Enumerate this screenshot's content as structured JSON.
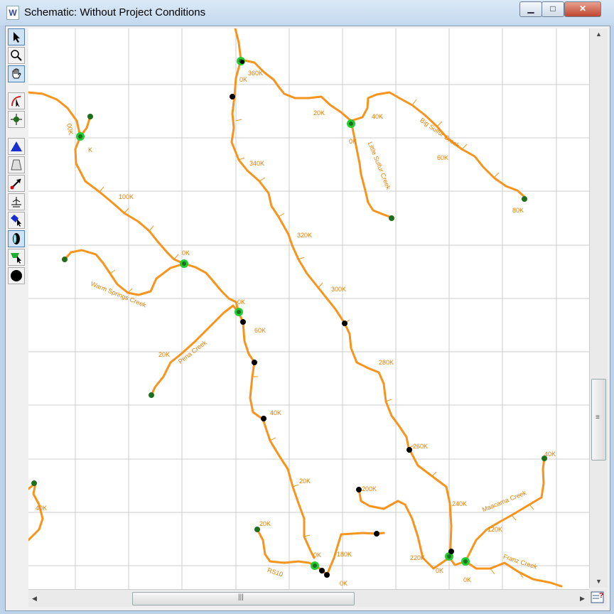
{
  "window": {
    "title": "Schematic: Without Project Conditions",
    "app_icon": "W",
    "minimize": "▁",
    "maximize": "□",
    "close": "✕"
  },
  "tools": [
    {
      "name": "select-arrow-icon"
    },
    {
      "name": "zoom-icon"
    },
    {
      "name": "pan-hand-icon"
    },
    {
      "name": "stream-tool-icon"
    },
    {
      "name": "junction-tool-icon"
    },
    {
      "name": "triangle-node-icon"
    },
    {
      "name": "reservoir-trapezoid-icon"
    },
    {
      "name": "diversion-arrow-icon"
    },
    {
      "name": "structure-icon"
    },
    {
      "name": "blue-select-icon"
    },
    {
      "name": "ellipse-tool-icon"
    },
    {
      "name": "green-select-icon"
    },
    {
      "name": "black-circle-icon"
    }
  ],
  "colors": {
    "river": "#f7941d",
    "label": "#e67e00",
    "green_node": "#22cc33",
    "dark_node": "#1e6e1e",
    "black_node": "#000000",
    "grid": "#cccccc"
  },
  "labels": {
    "l360k": "360K",
    "l0k_a": "0K",
    "l20k_a": "20K",
    "l40k_a": "40K",
    "l0k_b": "0K",
    "big_sulfur": "Big Sulfur Creek",
    "l60k_a": "60K",
    "l80k": "80K",
    "little_sulfur": "Little Sulfur Creek",
    "l00k": "00K",
    "lk": "K",
    "l340k": "340K",
    "l100k": "100K",
    "l320k": "320K",
    "l0k_c": "0K",
    "warm_springs": "Warm Springs Creek",
    "l0k_d": "0K",
    "l300k": "300K",
    "l60k_b": "60K",
    "l20k_b": "20K",
    "pena": "Pena Creek",
    "l280k": "280K",
    "l40k_b": "40K",
    "l260k": "260K",
    "l40k_c": "40K",
    "l20k_c": "20K",
    "l200k": "200K",
    "l240k": "240K",
    "maacama": "Maacama Creek",
    "l120k": "120K",
    "l20k_d": "20K",
    "l180k": "180K",
    "l0k_e": "0K",
    "l220k": "220K",
    "franz": "Franz Creek",
    "l0k_f": "0K",
    "l0k_g": "0K",
    "l0k_h": "0K",
    "rs10": "RS10",
    "l40k_d": "40K"
  },
  "scrollbar": {
    "grip": "≡",
    "hgrip": "|||",
    "up": "▲",
    "down": "▼",
    "left": "◀",
    "right": "▶"
  }
}
